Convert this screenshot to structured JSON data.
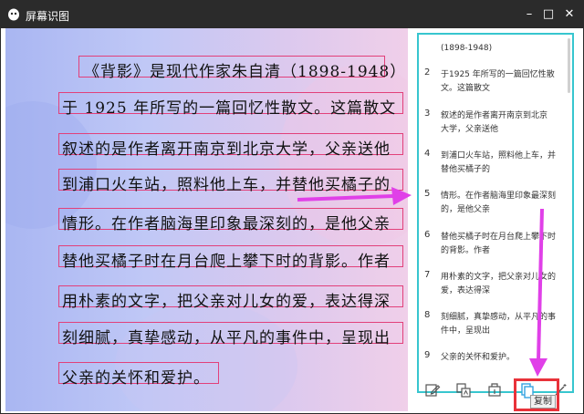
{
  "window": {
    "title": "屏幕识图",
    "minimize": "–",
    "maximize": "□",
    "close": "✕"
  },
  "document": {
    "lines": [
      "《背影》是现代作家朱自清（1898-1948）",
      "于 1925 年所写的一篇回忆性散文。这篇散文",
      "叙述的是作者离开南京到北京大学，父亲送他",
      "到浦口火车站，照料他上车，并替他买橘子的",
      "情形。在作者脑海里印象最深刻的，是他父亲",
      "替他买橘子时在月台爬上攀下时的背影。作者",
      "用朴素的文字，把父亲对儿女的爱，表达得深",
      "刻细腻，真挚感动，从平凡的事件中，呈现出",
      "父亲的关怀和爱护。"
    ]
  },
  "results": {
    "partial_top": "(1898-1948)",
    "items": [
      {
        "num": "2",
        "lines": [
          "于1925 年所写的一篇回忆性散",
          "文。这篇散文"
        ]
      },
      {
        "num": "3",
        "lines": [
          "叙述的是作者离开南京到北京",
          "大学，父亲送他"
        ]
      },
      {
        "num": "4",
        "lines": [
          "到浦口火车站，照料他上车，并",
          "替他买橘子的"
        ]
      },
      {
        "num": "5",
        "lines": [
          "情形。在作者脑海里印象最深刻",
          "的，是他父亲"
        ]
      },
      {
        "num": "6",
        "lines": [
          "替他买橘子时在月台爬上攀下时",
          "的背影。作者"
        ]
      },
      {
        "num": "7",
        "lines": [
          "用朴素的文字，把父亲对儿女的",
          "爱，表达得深"
        ]
      },
      {
        "num": "8",
        "lines": [
          "刻细腻，真挚感动，从平凡的事",
          "件中，呈现出"
        ]
      },
      {
        "num": "9",
        "lines": [
          "父亲的关怀和爱护。"
        ]
      }
    ]
  },
  "toolbar": {
    "copy_tooltip": "复制",
    "icons": [
      "edit-icon",
      "translate-icon",
      "export-icon",
      "copy-icon"
    ]
  },
  "colors": {
    "titlebar": "#2b2b2b",
    "result_border": "#37c6cf",
    "highlight": "#e2407a",
    "arrow": "#e040e8",
    "red_frame": "#e8323a"
  }
}
